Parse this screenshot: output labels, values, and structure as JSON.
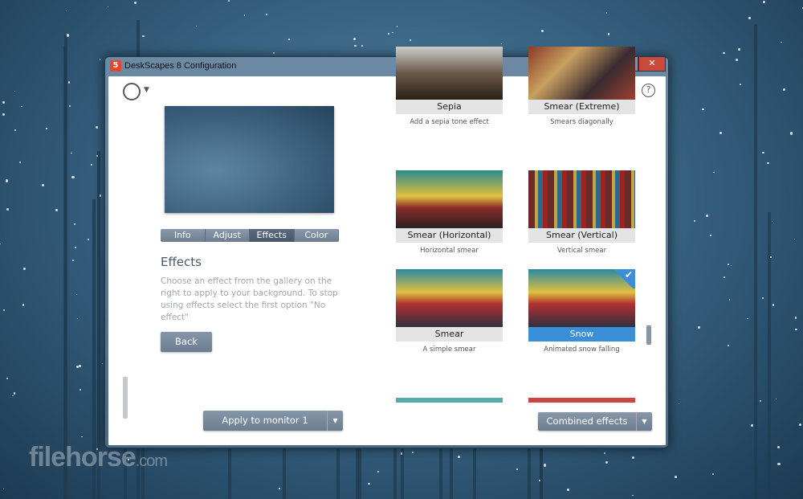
{
  "window": {
    "title": "DeskScapes 8 Configuration",
    "app_icon": "5",
    "minimize": "▬",
    "maximize": "□",
    "close": "✕"
  },
  "toolbar": {
    "monitor_icon": "monitor-layout-icon",
    "search_icon": "⚲",
    "settings_icon": "⚙",
    "help_icon": "?"
  },
  "left": {
    "tabs": [
      {
        "label": "Info"
      },
      {
        "label": "Adjust"
      },
      {
        "label": "Effects",
        "active": true
      },
      {
        "label": "Color"
      }
    ],
    "heading": "Effects",
    "description": "Choose an effect from the gallery on the right to apply to your background.  To stop using effects select the first option \"No effect\"",
    "back_label": "Back",
    "apply_label": "Apply to monitor 1"
  },
  "gallery": {
    "items": [
      {
        "name": "Sepia",
        "desc": "Add a sepia tone effect"
      },
      {
        "name": "Smear (Extreme)",
        "desc": "Smears diagonally"
      },
      {
        "name": "Smear (Horizontal)",
        "desc": "Horizontal smear"
      },
      {
        "name": "Smear (Vertical)",
        "desc": "Vertical smear"
      },
      {
        "name": "Smear",
        "desc": "A simple smear"
      },
      {
        "name": "Snow",
        "desc": "Animated snow falling",
        "selected": true
      }
    ],
    "combined_label": "Combined effects"
  },
  "watermark": {
    "brand": "filehorse",
    ".com": ".com"
  },
  "colors": {
    "accent": "#3b8fd9",
    "button": "#7a8a9d"
  }
}
